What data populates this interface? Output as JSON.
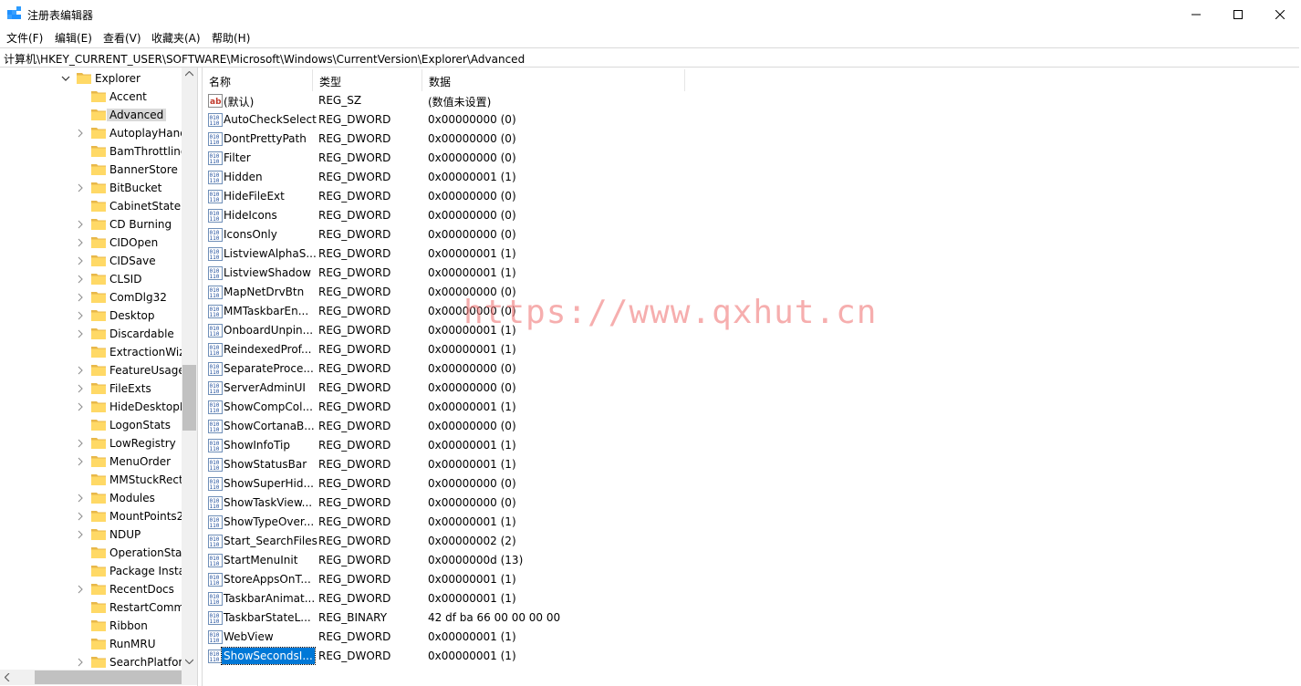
{
  "window": {
    "title": "注册表编辑器"
  },
  "menu": [
    "文件(F)",
    "编辑(E)",
    "查看(V)",
    "收藏夹(A)",
    "帮助(H)"
  ],
  "address": "计算机\\HKEY_CURRENT_USER\\SOFTWARE\\Microsoft\\Windows\\CurrentVersion\\Explorer\\Advanced",
  "tree": {
    "parent": {
      "label": "Explorer",
      "expanded": true
    },
    "children": [
      {
        "label": "Accent",
        "expandable": false
      },
      {
        "label": "Advanced",
        "expandable": false,
        "selected": true
      },
      {
        "label": "AutoplayHand",
        "expandable": true
      },
      {
        "label": "BamThrottling",
        "expandable": false
      },
      {
        "label": "BannerStore",
        "expandable": false
      },
      {
        "label": "BitBucket",
        "expandable": true
      },
      {
        "label": "CabinetState",
        "expandable": false
      },
      {
        "label": "CD Burning",
        "expandable": true
      },
      {
        "label": "CIDOpen",
        "expandable": true
      },
      {
        "label": "CIDSave",
        "expandable": true
      },
      {
        "label": "CLSID",
        "expandable": true
      },
      {
        "label": "ComDlg32",
        "expandable": true
      },
      {
        "label": "Desktop",
        "expandable": true
      },
      {
        "label": "Discardable",
        "expandable": true
      },
      {
        "label": "ExtractionWiz",
        "expandable": false
      },
      {
        "label": "FeatureUsage",
        "expandable": true
      },
      {
        "label": "FileExts",
        "expandable": true
      },
      {
        "label": "HideDesktopI",
        "expandable": true
      },
      {
        "label": "LogonStats",
        "expandable": false
      },
      {
        "label": "LowRegistry",
        "expandable": true
      },
      {
        "label": "MenuOrder",
        "expandable": true
      },
      {
        "label": "MMStuckRect",
        "expandable": false
      },
      {
        "label": "Modules",
        "expandable": true
      },
      {
        "label": "MountPoints2",
        "expandable": true
      },
      {
        "label": "NDUP",
        "expandable": true
      },
      {
        "label": "OperationStat",
        "expandable": false
      },
      {
        "label": "Package Insta",
        "expandable": false
      },
      {
        "label": "RecentDocs",
        "expandable": true
      },
      {
        "label": "RestartComm",
        "expandable": false
      },
      {
        "label": "Ribbon",
        "expandable": false
      },
      {
        "label": "RunMRU",
        "expandable": false
      },
      {
        "label": "SearchPlatfor",
        "expandable": true
      }
    ]
  },
  "columns": [
    "名称",
    "类型",
    "数据"
  ],
  "values": [
    {
      "name": "(默认)",
      "type": "REG_SZ",
      "data": "(数值未设置)",
      "icon": "string-value-icon"
    },
    {
      "name": "AutoCheckSelect",
      "type": "REG_DWORD",
      "data": "0x00000000 (0)",
      "icon": "binary-value-icon"
    },
    {
      "name": "DontPrettyPath",
      "type": "REG_DWORD",
      "data": "0x00000000 (0)",
      "icon": "binary-value-icon"
    },
    {
      "name": "Filter",
      "type": "REG_DWORD",
      "data": "0x00000000 (0)",
      "icon": "binary-value-icon"
    },
    {
      "name": "Hidden",
      "type": "REG_DWORD",
      "data": "0x00000001 (1)",
      "icon": "binary-value-icon"
    },
    {
      "name": "HideFileExt",
      "type": "REG_DWORD",
      "data": "0x00000000 (0)",
      "icon": "binary-value-icon"
    },
    {
      "name": "HideIcons",
      "type": "REG_DWORD",
      "data": "0x00000000 (0)",
      "icon": "binary-value-icon"
    },
    {
      "name": "IconsOnly",
      "type": "REG_DWORD",
      "data": "0x00000000 (0)",
      "icon": "binary-value-icon"
    },
    {
      "name": "ListviewAlphaS...",
      "type": "REG_DWORD",
      "data": "0x00000001 (1)",
      "icon": "binary-value-icon"
    },
    {
      "name": "ListviewShadow",
      "type": "REG_DWORD",
      "data": "0x00000001 (1)",
      "icon": "binary-value-icon"
    },
    {
      "name": "MapNetDrvBtn",
      "type": "REG_DWORD",
      "data": "0x00000000 (0)",
      "icon": "binary-value-icon"
    },
    {
      "name": "MMTaskbarEn...",
      "type": "REG_DWORD",
      "data": "0x00000000 (0)",
      "icon": "binary-value-icon"
    },
    {
      "name": "OnboardUnpin...",
      "type": "REG_DWORD",
      "data": "0x00000001 (1)",
      "icon": "binary-value-icon"
    },
    {
      "name": "ReindexedProf...",
      "type": "REG_DWORD",
      "data": "0x00000001 (1)",
      "icon": "binary-value-icon"
    },
    {
      "name": "SeparateProce...",
      "type": "REG_DWORD",
      "data": "0x00000000 (0)",
      "icon": "binary-value-icon"
    },
    {
      "name": "ServerAdminUI",
      "type": "REG_DWORD",
      "data": "0x00000000 (0)",
      "icon": "binary-value-icon"
    },
    {
      "name": "ShowCompCol...",
      "type": "REG_DWORD",
      "data": "0x00000001 (1)",
      "icon": "binary-value-icon"
    },
    {
      "name": "ShowCortanaB...",
      "type": "REG_DWORD",
      "data": "0x00000000 (0)",
      "icon": "binary-value-icon"
    },
    {
      "name": "ShowInfoTip",
      "type": "REG_DWORD",
      "data": "0x00000001 (1)",
      "icon": "binary-value-icon"
    },
    {
      "name": "ShowStatusBar",
      "type": "REG_DWORD",
      "data": "0x00000001 (1)",
      "icon": "binary-value-icon"
    },
    {
      "name": "ShowSuperHid...",
      "type": "REG_DWORD",
      "data": "0x00000000 (0)",
      "icon": "binary-value-icon"
    },
    {
      "name": "ShowTaskView...",
      "type": "REG_DWORD",
      "data": "0x00000000 (0)",
      "icon": "binary-value-icon"
    },
    {
      "name": "ShowTypeOver...",
      "type": "REG_DWORD",
      "data": "0x00000001 (1)",
      "icon": "binary-value-icon"
    },
    {
      "name": "Start_SearchFiles",
      "type": "REG_DWORD",
      "data": "0x00000002 (2)",
      "icon": "binary-value-icon"
    },
    {
      "name": "StartMenuInit",
      "type": "REG_DWORD",
      "data": "0x0000000d (13)",
      "icon": "binary-value-icon"
    },
    {
      "name": "StoreAppsOnT...",
      "type": "REG_DWORD",
      "data": "0x00000001 (1)",
      "icon": "binary-value-icon"
    },
    {
      "name": "TaskbarAnimat...",
      "type": "REG_DWORD",
      "data": "0x00000001 (1)",
      "icon": "binary-value-icon"
    },
    {
      "name": "TaskbarStateL...",
      "type": "REG_BINARY",
      "data": "42 df ba 66 00 00 00 00",
      "icon": "binary-value-icon"
    },
    {
      "name": "WebView",
      "type": "REG_DWORD",
      "data": "0x00000001 (1)",
      "icon": "binary-value-icon"
    },
    {
      "name": "ShowSecondsI...",
      "type": "REG_DWORD",
      "data": "0x00000001 (1)",
      "icon": "binary-value-icon",
      "selected": true
    }
  ],
  "watermark": "https://www.qxhut.cn",
  "colors": {
    "selection": "#0078d7",
    "folder": "#ffd966",
    "folder_dark": "#e8b84a"
  }
}
